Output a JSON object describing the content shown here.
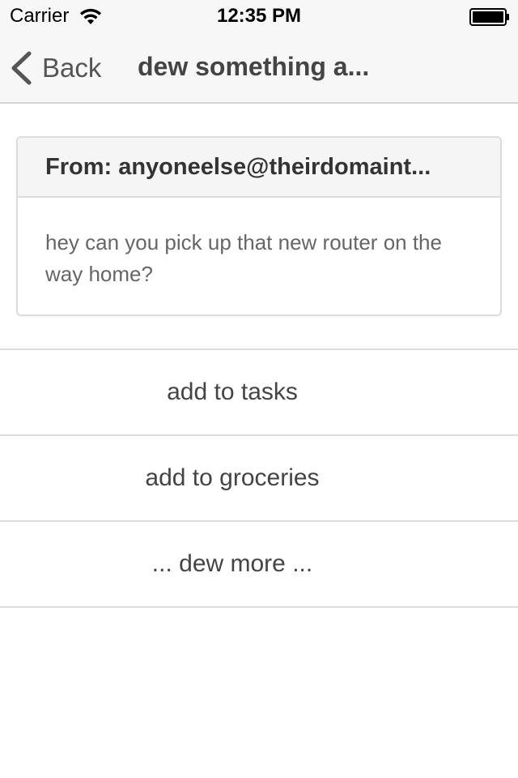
{
  "status_bar": {
    "carrier": "Carrier",
    "time": "12:35 PM",
    "wifi_icon": "wifi-icon",
    "battery_icon": "battery-icon"
  },
  "nav": {
    "back_label": "Back",
    "back_icon": "chevron-left-icon",
    "title": "dew something a..."
  },
  "message": {
    "from": "From: anyoneelse@theirdomaint...",
    "body": "hey can you pick up that new router on the way home?"
  },
  "actions": [
    {
      "label": "add to tasks"
    },
    {
      "label": "add to groceries"
    },
    {
      "label": "... dew more ..."
    }
  ],
  "colors": {
    "bar_background": "#f7f7f7",
    "divider": "#dddddd",
    "text": "#444444"
  }
}
